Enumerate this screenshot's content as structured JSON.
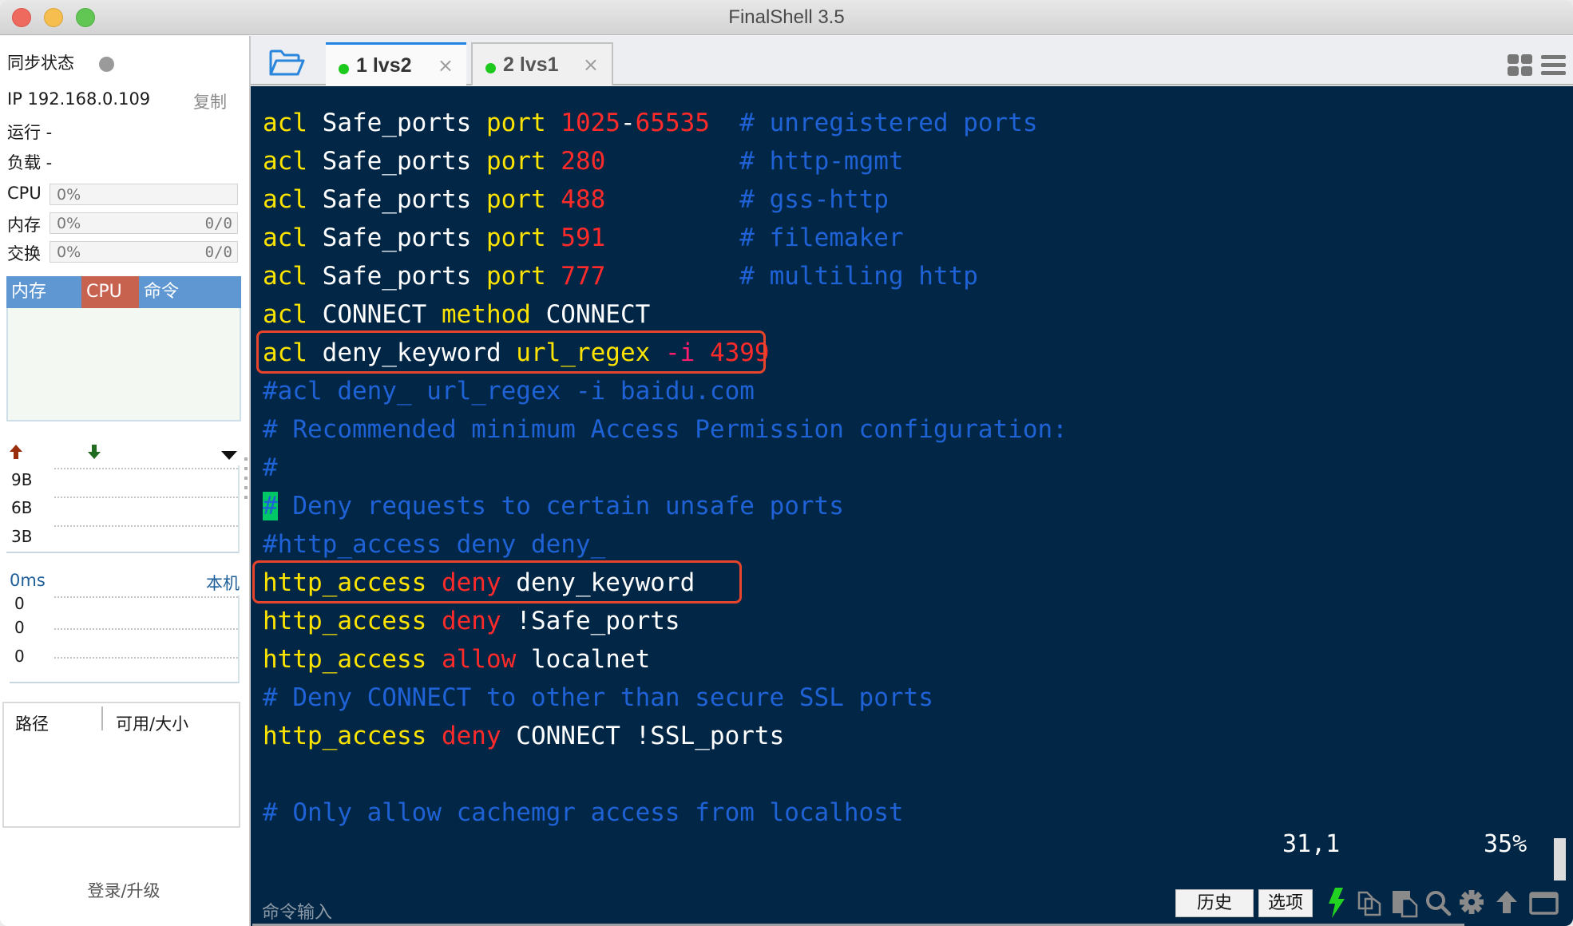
{
  "window": {
    "title": "FinalShell 3.5"
  },
  "sidebar": {
    "sync_status_label": "同步状态",
    "ip_label": "IP 192.168.0.109",
    "copy_label": "复制",
    "uptime_label": "运行 -",
    "load_label": "负载 -",
    "meters": [
      {
        "label": "CPU",
        "percent": "0%",
        "ratio": ""
      },
      {
        "label": "内存",
        "percent": "0%",
        "ratio": "0/0"
      },
      {
        "label": "交换",
        "percent": "0%",
        "ratio": "0/0"
      }
    ],
    "process_tabs": [
      "内存",
      "CPU",
      "命令"
    ],
    "process_tabs_colors": {
      "default": "#5e97d2",
      "active": "#c7624f"
    },
    "network": {
      "up_icon": "arrow-up-icon",
      "down_icon": "arrow-down-icon",
      "dropdown_icon": "triangle-down-icon",
      "y_labels": [
        "9B",
        "6B",
        "3B"
      ]
    },
    "ping": {
      "latency": "0ms",
      "host": "本机",
      "y_labels": [
        "0",
        "0",
        "0"
      ]
    },
    "disk_table": {
      "columns": [
        "路径",
        "可用/大小"
      ]
    },
    "login_label": "登录/升级"
  },
  "tabs": [
    {
      "number": "1",
      "name": "lvs2",
      "label": "1 lvs2",
      "active": true,
      "status_color": "#1dc91d"
    },
    {
      "number": "2",
      "name": "lvs1",
      "label": "2 lvs1",
      "active": false,
      "status_color": "#1dc91d"
    }
  ],
  "tab_close_glyph": "×",
  "terminal": {
    "lines": [
      [
        [
          "acl ",
          "yel"
        ],
        [
          "Safe_ports ",
          "wht"
        ],
        [
          "port ",
          "yel"
        ],
        [
          "1025",
          "red"
        ],
        [
          "-",
          "wht"
        ],
        [
          "65535",
          "red"
        ],
        [
          "  ",
          "wht"
        ],
        [
          "# unregistered ports",
          "cmt"
        ]
      ],
      [
        [
          "acl ",
          "yel"
        ],
        [
          "Safe_ports ",
          "wht"
        ],
        [
          "port ",
          "yel"
        ],
        [
          "280",
          "red"
        ],
        [
          "         ",
          "wht"
        ],
        [
          "# http-mgmt",
          "cmt"
        ]
      ],
      [
        [
          "acl ",
          "yel"
        ],
        [
          "Safe_ports ",
          "wht"
        ],
        [
          "port ",
          "yel"
        ],
        [
          "488",
          "red"
        ],
        [
          "         ",
          "wht"
        ],
        [
          "# gss-http",
          "cmt"
        ]
      ],
      [
        [
          "acl ",
          "yel"
        ],
        [
          "Safe_ports ",
          "wht"
        ],
        [
          "port ",
          "yel"
        ],
        [
          "591",
          "red"
        ],
        [
          "         ",
          "wht"
        ],
        [
          "# filemaker",
          "cmt"
        ]
      ],
      [
        [
          "acl ",
          "yel"
        ],
        [
          "Safe_ports ",
          "wht"
        ],
        [
          "port ",
          "yel"
        ],
        [
          "777",
          "red"
        ],
        [
          "         ",
          "wht"
        ],
        [
          "# multiling http",
          "cmt"
        ]
      ],
      [
        [
          "acl ",
          "yel"
        ],
        [
          "CONNECT ",
          "wht"
        ],
        [
          "method ",
          "yel"
        ],
        [
          "CONNECT",
          "wht"
        ]
      ],
      [
        [
          "acl ",
          "yel"
        ],
        [
          "deny_keyword ",
          "wht"
        ],
        [
          "url_regex ",
          "yel"
        ],
        [
          "-i ",
          "mag"
        ],
        [
          "4399",
          "red"
        ]
      ],
      [
        [
          "#acl deny_ url_regex -i baidu.com",
          "cmt"
        ]
      ],
      [
        [
          "# Recommended minimum Access Permission configuration:",
          "cmt"
        ]
      ],
      [
        [
          "#",
          "cmt"
        ]
      ],
      [
        [
          "#",
          "cursor"
        ],
        [
          " Deny requests to certain unsafe ports",
          "cmt"
        ]
      ],
      [
        [
          "#http_access deny deny_",
          "cmt"
        ]
      ],
      [
        [
          "http_access ",
          "yel"
        ],
        [
          "deny ",
          "red"
        ],
        [
          "deny_keyword",
          "wht"
        ]
      ],
      [
        [
          "http_access ",
          "yel"
        ],
        [
          "deny ",
          "red"
        ],
        [
          "!Safe_ports",
          "wht"
        ]
      ],
      [
        [
          "http_access ",
          "yel"
        ],
        [
          "allow ",
          "red"
        ],
        [
          "localnet",
          "wht"
        ]
      ],
      [
        [
          "# Deny CONNECT to other than secure SSL ports",
          "cmt"
        ]
      ],
      [
        [
          "http_access ",
          "yel"
        ],
        [
          "deny ",
          "red"
        ],
        [
          "CONNECT !SSL_ports",
          "wht"
        ]
      ],
      [
        [
          "",
          "wht"
        ]
      ],
      [
        [
          "# Only allow cachemgr access from localhost",
          "cmt"
        ]
      ]
    ],
    "highlighted_lines": [
      7,
      13
    ],
    "highlight_color": "#e8432b",
    "cursor_position": "31,1",
    "scroll_percent": "35%",
    "colors": {
      "background": "#022645",
      "keyword": "#fce300",
      "text": "#ffffff",
      "value": "#ff2a2a",
      "comment": "#1e62d6",
      "cursor": "#00c766"
    }
  },
  "bottom_bar": {
    "command_placeholder": "命令输入",
    "history_label": "历史",
    "options_label": "选项",
    "icons": [
      "lightning-icon",
      "copy-icon",
      "paste-icon",
      "search-icon",
      "gear-icon",
      "arrow-up-icon",
      "window-icon"
    ]
  }
}
